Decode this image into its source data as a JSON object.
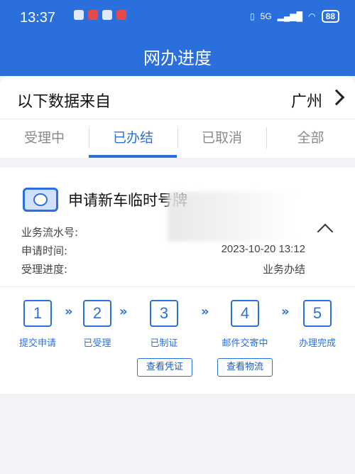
{
  "status_bar": {
    "time": "13:37",
    "network": "5G",
    "battery": "88"
  },
  "header": {
    "title": "网办进度"
  },
  "source": {
    "label": "以下数据来自",
    "city": "广州"
  },
  "tabs": [
    {
      "label": "受理中",
      "active": false
    },
    {
      "label": "已办结",
      "active": true
    },
    {
      "label": "已取消",
      "active": false
    },
    {
      "label": "全部",
      "active": false
    }
  ],
  "card": {
    "title": "申请新车临时号牌",
    "fields": [
      {
        "label": "业务流水号:",
        "value": ""
      },
      {
        "label": "申请时间:",
        "value": "2023-10-20 13:12"
      },
      {
        "label": "受理进度:",
        "value": "业务办结"
      }
    ],
    "steps": [
      {
        "num": "1",
        "label": "提交申请"
      },
      {
        "num": "2",
        "label": "已受理"
      },
      {
        "num": "3",
        "label": "已制证"
      },
      {
        "num": "4",
        "label": "邮件交寄中"
      },
      {
        "num": "5",
        "label": "办理完成"
      }
    ],
    "arrow_glyph": "»",
    "buttons": [
      {
        "label": "查看凭证"
      },
      {
        "label": "查看物流"
      }
    ]
  },
  "colors": {
    "accent": "#2b6fdc",
    "background": "#f2f3f7"
  }
}
